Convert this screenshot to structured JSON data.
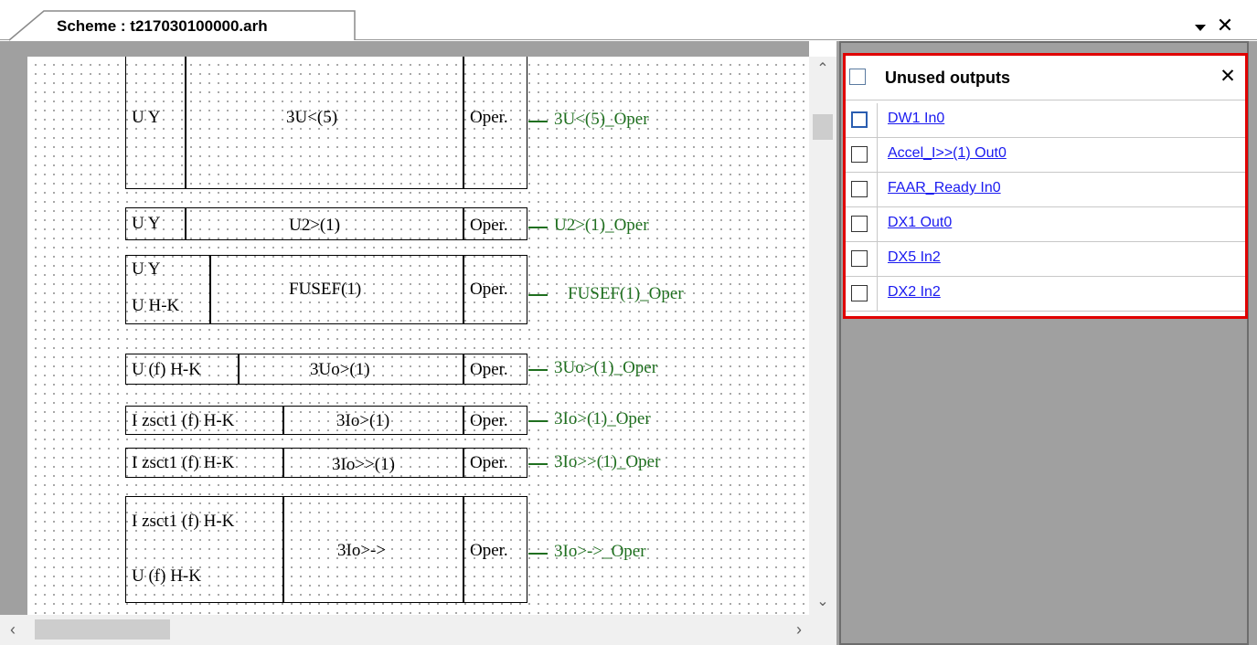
{
  "tab": {
    "label": "Scheme : t217030100000.arh",
    "dropdown_icon": "chevron-down",
    "close_icon": "close"
  },
  "scheme_blocks": [
    {
      "inputs": [
        "U Y"
      ],
      "function": "3U<(5)",
      "output": "Oper.",
      "signal": "3U<(5)_Oper"
    },
    {
      "inputs": [
        "U Y"
      ],
      "function": "U2>(1)",
      "output": "Oper.",
      "signal": "U2>(1)_Oper"
    },
    {
      "inputs": [
        "U Y",
        "U H-K"
      ],
      "function": "FUSEF(1)",
      "output": "Oper.",
      "signal": "FUSEF(1)_Oper"
    },
    {
      "inputs": [
        "U (f) H-K"
      ],
      "function": "3Uo>(1)",
      "output": "Oper.",
      "signal": "3Uo>(1)_Oper"
    },
    {
      "inputs": [
        "I zsct1 (f) H-K"
      ],
      "function": "3Io>(1)",
      "output": "Oper.",
      "signal": "3Io>(1)_Oper"
    },
    {
      "inputs": [
        "I zsct1 (f) H-K"
      ],
      "function": "3Io>>(1)",
      "output": "Oper.",
      "signal": "3Io>>(1)_Oper"
    },
    {
      "inputs": [
        "I zsct1 (f) H-K",
        "U (f) H-K"
      ],
      "function": "3Io>->",
      "output": "Oper.",
      "signal": "3Io>->_Oper"
    }
  ],
  "unused_outputs": {
    "title": "Unused outputs",
    "close_icon": "close",
    "items": [
      {
        "label": "DW1 In0",
        "checked": false
      },
      {
        "label": "Accel_I>>(1) Out0",
        "checked": false
      },
      {
        "label": "FAAR_Ready In0",
        "checked": false
      },
      {
        "label": "DX1 Out0",
        "checked": false
      },
      {
        "label": "DX5 In2",
        "checked": false
      },
      {
        "label": "DX2 In2",
        "checked": false
      }
    ]
  },
  "colors": {
    "signal": "#1f6f1f",
    "link": "#1a1af0",
    "highlight": "#e00000",
    "panel_bg": "#a0a0a0"
  }
}
